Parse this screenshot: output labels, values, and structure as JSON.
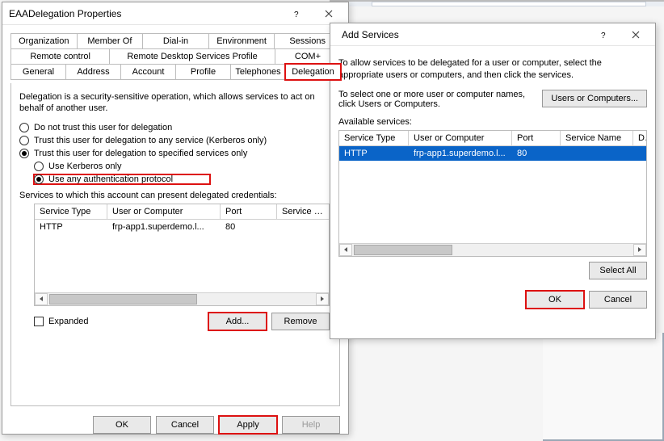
{
  "left_window": {
    "title": "EAADelegation Properties",
    "tabs_row1": [
      "Organization",
      "Member Of",
      "Dial-in",
      "Environment",
      "Sessions"
    ],
    "tabs_row2": [
      "Remote control",
      "Remote Desktop Services Profile",
      "COM+"
    ],
    "tabs_row3": [
      "General",
      "Address",
      "Account",
      "Profile",
      "Telephones",
      "Delegation"
    ],
    "active_tab_index": 5,
    "description": "Delegation is a security-sensitive operation, which allows services to act on behalf of another user.",
    "radio_no_trust": "Do not trust this user for delegation",
    "radio_any_service": "Trust this user for delegation to any service (Kerberos only)",
    "radio_specified": "Trust this user for delegation to specified services only",
    "radio_kerberos": "Use Kerberos only",
    "radio_any_auth": "Use any authentication protocol",
    "services_caption": "Services to which this account can present delegated credentials:",
    "columns": {
      "c1": "Service Type",
      "c2": "User or Computer",
      "c3": "Port",
      "c4": "Service N..."
    },
    "row": {
      "type": "HTTP",
      "uoc": "frp-app1.superdemo.l...",
      "port": "80"
    },
    "expanded": "Expanded",
    "add": "Add...",
    "remove": "Remove",
    "ok": "OK",
    "cancel": "Cancel",
    "apply": "Apply",
    "help": "Help"
  },
  "right_window": {
    "title": "Add Services",
    "intro": "To allow services to be delegated for a user or computer, select the appropriate users or computers, and then click the services.",
    "uoc_text": "To select one or more user or computer names, click Users or Computers.",
    "uoc_btn": "Users or Computers...",
    "available": "Available services:",
    "columns": {
      "c1": "Service Type",
      "c2": "User or Computer",
      "c3": "Port",
      "c4": "Service Name",
      "c5": "D"
    },
    "row": {
      "type": "HTTP",
      "uoc": "frp-app1.superdemo.l...",
      "port": "80"
    },
    "select_all": "Select All",
    "ok": "OK",
    "cancel": "Cancel"
  }
}
